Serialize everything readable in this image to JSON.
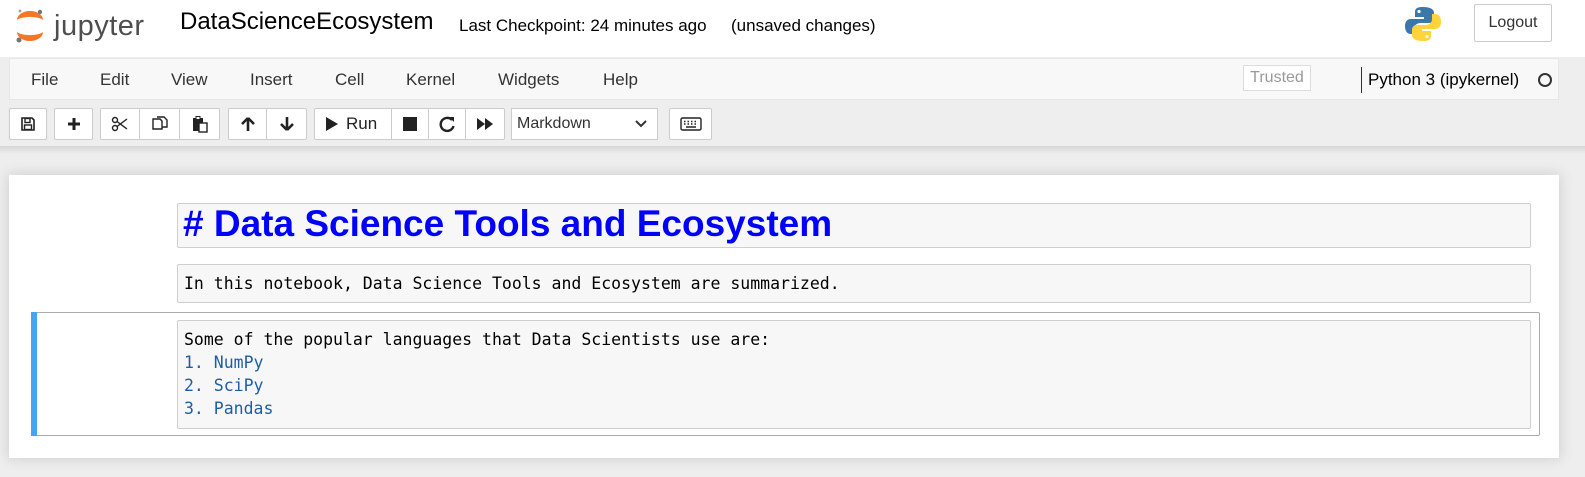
{
  "header": {
    "logo_text": "jupyter",
    "notebook_name": "DataScienceEcosystem",
    "checkpoint": "Last Checkpoint: 24 minutes ago",
    "unsaved": "(unsaved changes)",
    "logout_label": "Logout"
  },
  "menubar": {
    "items": [
      "File",
      "Edit",
      "View",
      "Insert",
      "Cell",
      "Kernel",
      "Widgets",
      "Help"
    ],
    "trusted_label": "Trusted",
    "kernel_name": "Python 3 (ipykernel)"
  },
  "toolbar": {
    "run_label": "Run",
    "cell_type": "Markdown",
    "icons": [
      "save-icon",
      "plus-icon",
      "cut-icon",
      "copy-icon",
      "paste-icon",
      "arrow-up-icon",
      "arrow-down-icon",
      "play-icon",
      "stop-icon",
      "restart-icon",
      "fast-forward-icon",
      "keyboard-icon"
    ]
  },
  "cells": [
    {
      "type": "markdown",
      "text": "# Data Science Tools and Ecosystem"
    },
    {
      "type": "markdown",
      "text": "In this notebook, Data Science Tools and Ecosystem are summarized."
    },
    {
      "type": "markdown",
      "lines": [
        "Some of the popular languages that Data Scientists use are:",
        "1. NumPy",
        "2. SciPy",
        "3. Pandas"
      ]
    }
  ],
  "colors": {
    "heading": "#0000ff",
    "list": "#1f5ea6",
    "selection": "#42a5f5",
    "logo_orange": "#f37726"
  }
}
